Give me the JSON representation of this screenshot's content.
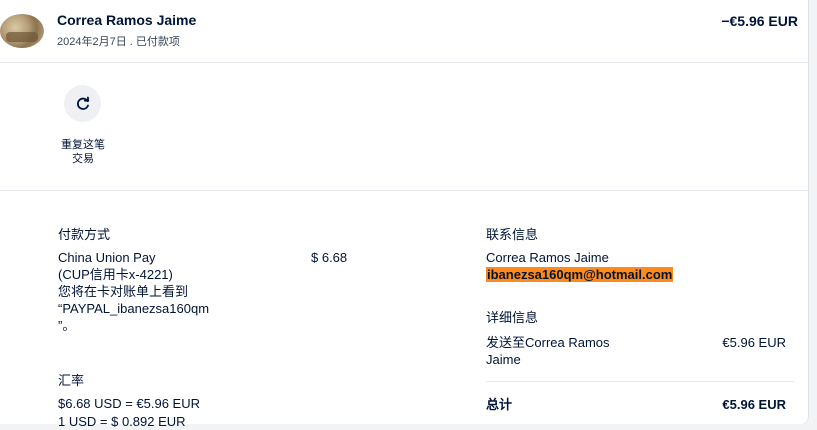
{
  "header": {
    "merchant_name": "Correa Ramos Jaime",
    "meta": "2024年2月7日 . 已付款项",
    "amount": "−€5.96 EUR"
  },
  "actions": {
    "repeat_label_line1": "重复这笔",
    "repeat_label_line2": "交易"
  },
  "payment_method": {
    "heading": "付款方式",
    "lines": [
      "China Union Pay",
      "(CUP信用卡x-4221)",
      "您将在卡对账单上看到",
      "“PAYPAL_ibanezsa160qm",
      "”。"
    ],
    "amount": "$ 6.68"
  },
  "exchange_rate": {
    "heading": "汇率",
    "line1": "$6.68 USD = €5.96 EUR",
    "line2": "1 USD = $ 0.892 EUR"
  },
  "contact": {
    "heading": "联系信息",
    "name": "Correa Ramos Jaime",
    "email": "ibanezsa160qm@hotmail.com"
  },
  "details": {
    "heading": "详细信息",
    "sent_to_line1": "发送至Correa Ramos",
    "sent_to_line2": "Jaime",
    "sent_amount": "€5.96 EUR",
    "total_label": "总计",
    "total_amount": "€5.96 EUR"
  },
  "colors": {
    "email_highlight": "#ff8a1c",
    "text": "#001435"
  },
  "icons": {
    "repeat": "refresh-icon"
  }
}
